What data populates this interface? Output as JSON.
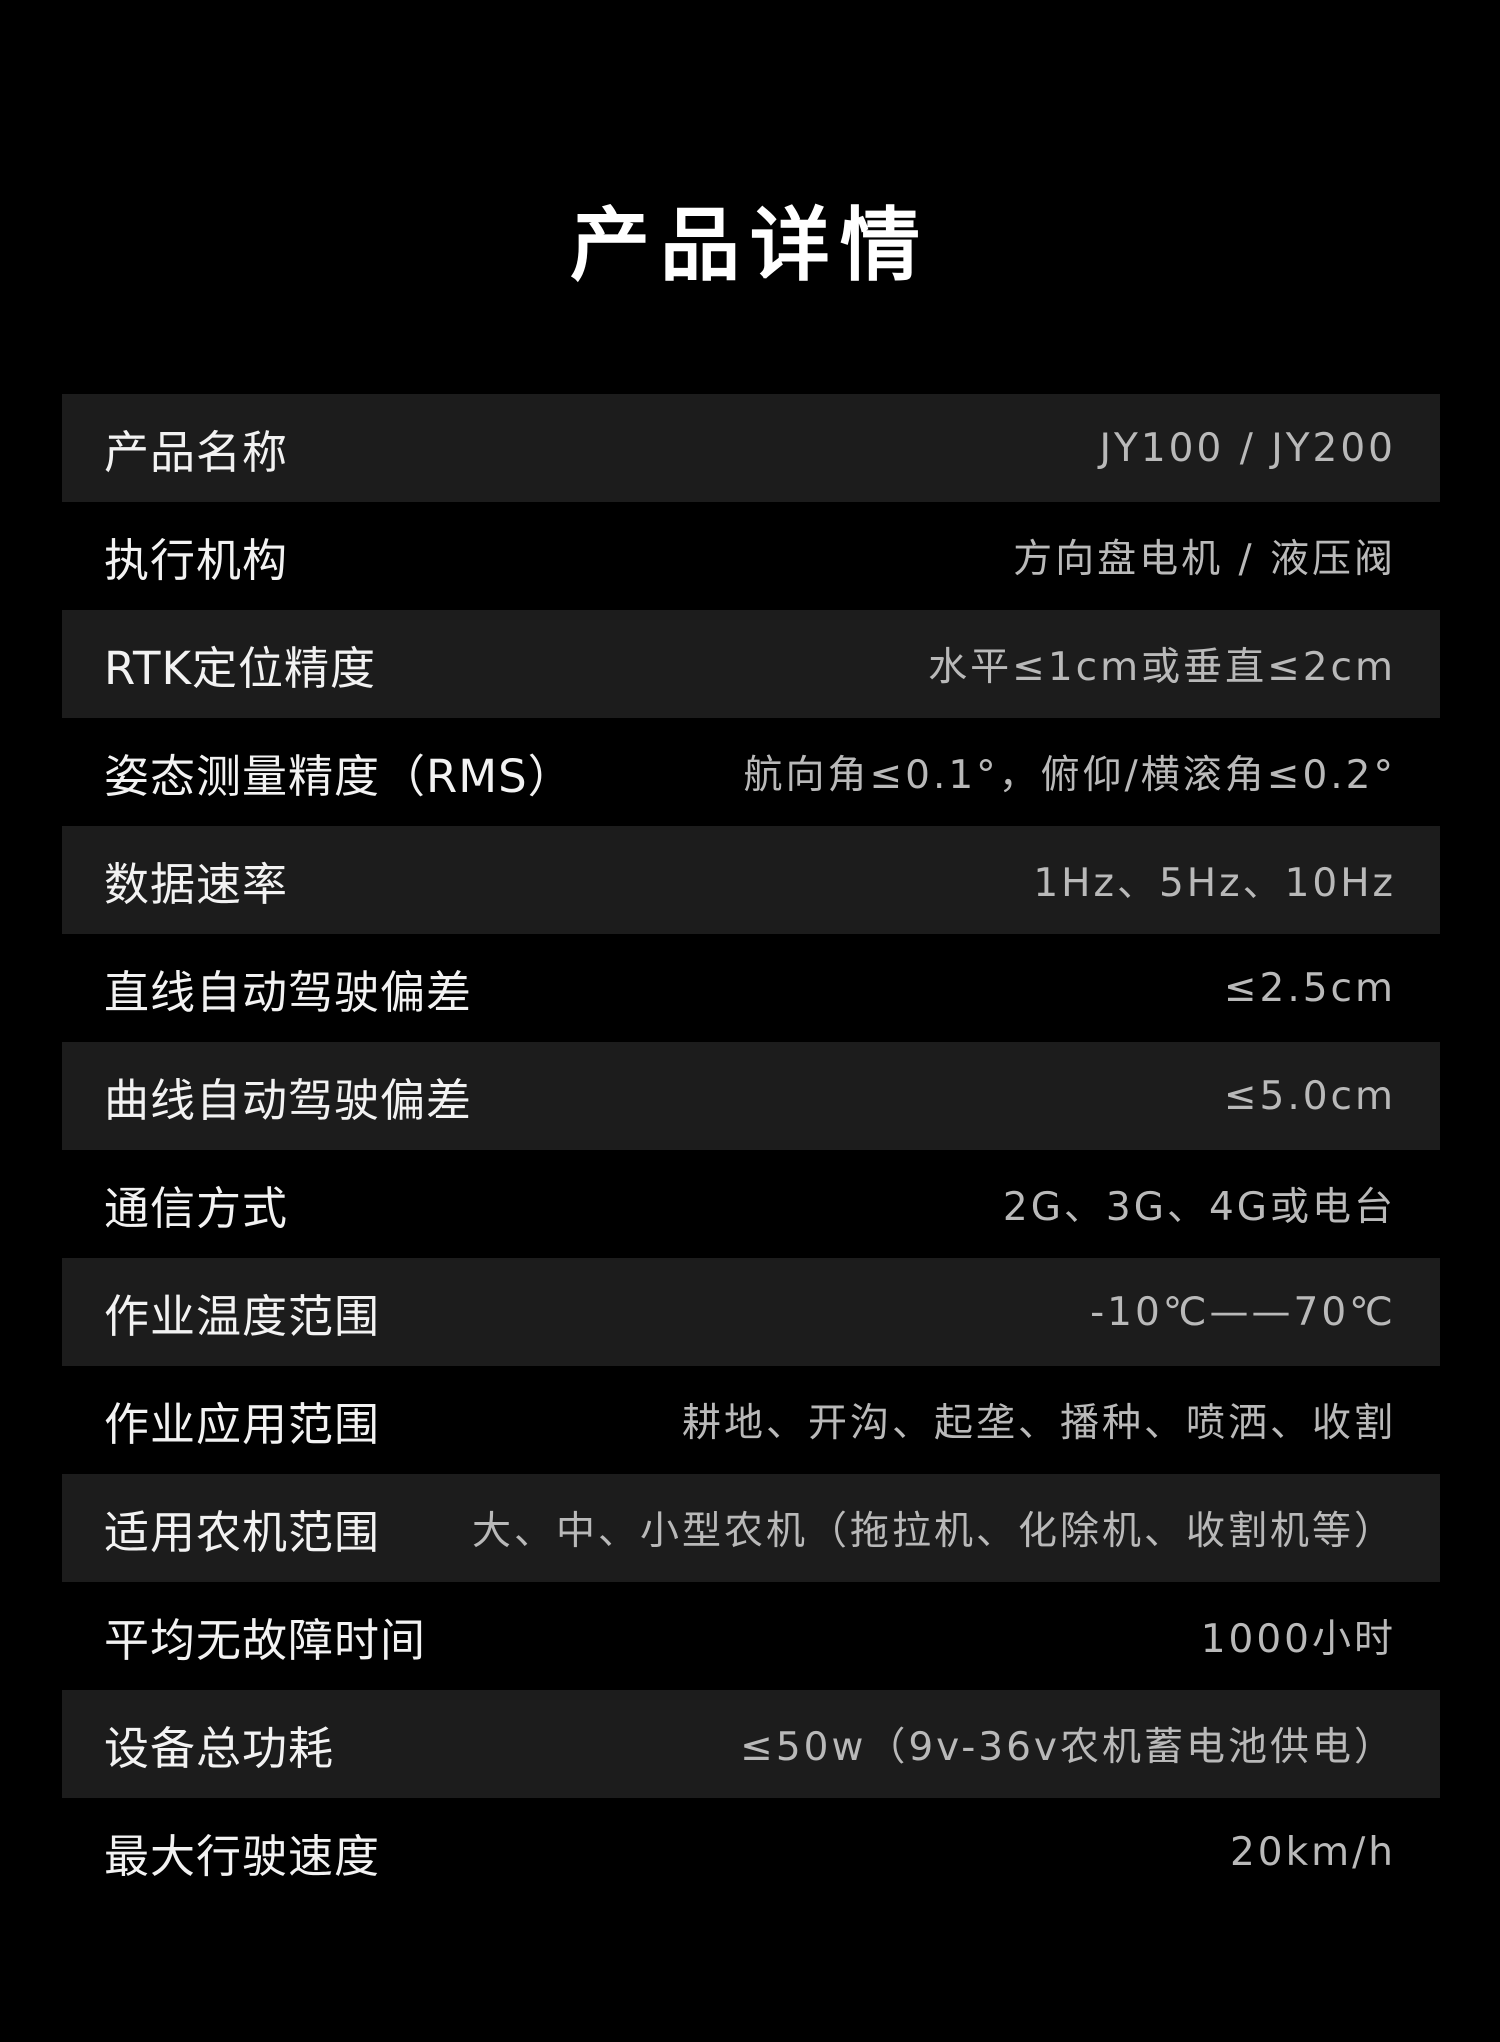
{
  "page": {
    "title": "产品详情"
  },
  "specs": [
    {
      "label": "产品名称",
      "value": "JY100 / JY200"
    },
    {
      "label": "执行机构",
      "value": "方向盘电机 / 液压阀"
    },
    {
      "label": "RTK定位精度",
      "value": "水平≤1cm或垂直≤2cm"
    },
    {
      "label": "姿态测量精度（RMS）",
      "value": "航向角≤0.1°，俯仰/横滚角≤0.2°"
    },
    {
      "label": "数据速率",
      "value": "1Hz、5Hz、10Hz"
    },
    {
      "label": "直线自动驾驶偏差",
      "value": "≤2.5cm"
    },
    {
      "label": "曲线自动驾驶偏差",
      "value": "≤5.0cm"
    },
    {
      "label": "通信方式",
      "value": "2G、3G、4G或电台"
    },
    {
      "label": "作业温度范围",
      "value": "-10℃——70℃"
    },
    {
      "label": "作业应用范围",
      "value": "耕地、开沟、起垄、播种、喷洒、收割"
    },
    {
      "label": "适用农机范围",
      "value": "大、中、小型农机（拖拉机、化除机、收割机等）"
    },
    {
      "label": "平均无故障时间",
      "value": "1000小时"
    },
    {
      "label": "设备总功耗",
      "value": "≤50w（9v-36v农机蓄电池供电）"
    },
    {
      "label": "最大行驶速度",
      "value": "20km/h"
    }
  ],
  "colors": {
    "background": "#000000",
    "row_shade": "#1c1c1c",
    "label_text": "#f2f2f2",
    "value_text": "#b9b9b9"
  }
}
